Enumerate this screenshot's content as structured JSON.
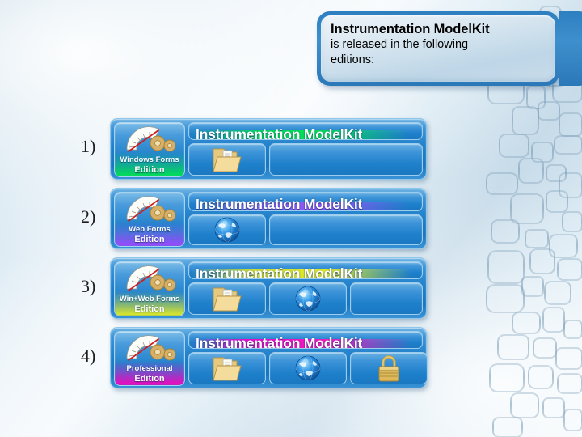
{
  "callout": {
    "title": "Instrumentation ModelKit",
    "line2": "is released in the following",
    "line3": "editions:"
  },
  "product_name": "Instrumentation ModelKit",
  "colors": {
    "panel_blue": "#1e80cb",
    "panel_blue_light": "#6cb3e4",
    "callout_border": "#2e7fc0",
    "accent_green": "#00e64d",
    "accent_violet": "#9b5cff",
    "accent_yellow": "#ffe800",
    "accent_magenta": "#ff00cc"
  },
  "editions": [
    {
      "number": "1)",
      "badge_line1": "Windows Forms",
      "badge_line2": "Edition",
      "banner_title": "Instrumentation ModelKit",
      "accent": "#00e64d",
      "accent_name": "green",
      "features": [
        "folder-icon"
      ]
    },
    {
      "number": "2)",
      "badge_line1": "Web Forms",
      "badge_line2": "Edition",
      "banner_title": "Instrumentation ModelKit",
      "accent": "#9b5cff",
      "accent_name": "violet",
      "features": [
        "globe-icon"
      ]
    },
    {
      "number": "3)",
      "badge_line1": "Win+Web Forms",
      "badge_line2": "Edition",
      "banner_title": "Instrumentation ModelKit",
      "accent": "#ffe800",
      "accent_name": "yellow",
      "features": [
        "folder-icon",
        "globe-icon"
      ]
    },
    {
      "number": "4)",
      "badge_line1": "Professional",
      "badge_line2": "Edition",
      "banner_title": "Instrumentation ModelKit",
      "accent": "#ff00cc",
      "accent_name": "magenta",
      "features": [
        "folder-icon",
        "globe-icon",
        "lock-icon"
      ]
    }
  ]
}
